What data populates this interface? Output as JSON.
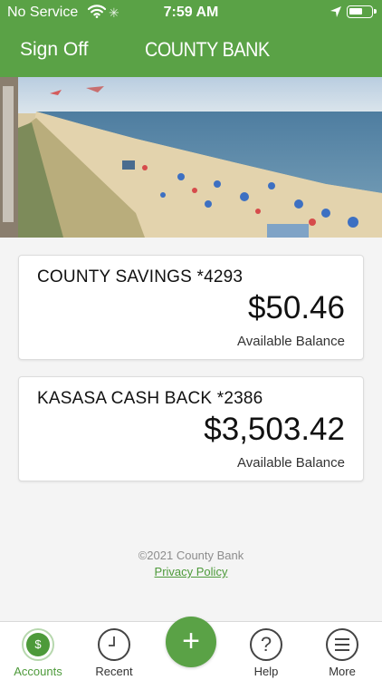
{
  "status_bar": {
    "carrier": "No Service",
    "time": "7:59 AM",
    "icons": [
      "wifi-icon",
      "loading-spinner-icon",
      "location-arrow-icon",
      "battery-icon"
    ]
  },
  "header": {
    "sign_off_label": "Sign Off",
    "brand": "COUNTY BANK",
    "color": "#5aa246"
  },
  "accounts": [
    {
      "name": "COUNTY SAVINGS *4293",
      "balance": "$50.46",
      "balance_label": "Available Balance"
    },
    {
      "name": "KASASA CASH BACK *2386",
      "balance": "$3,503.42",
      "balance_label": "Available Balance"
    }
  ],
  "footer": {
    "copyright": "©2021 County Bank",
    "privacy_link": "Privacy Policy"
  },
  "tabbar": {
    "accounts": {
      "label": "Accounts",
      "icon": "dollar-icon",
      "symbol": "$"
    },
    "recent": {
      "label": "Recent",
      "icon": "clock-icon"
    },
    "add": {
      "icon": "plus-icon",
      "symbol": "+"
    },
    "help": {
      "label": "Help",
      "icon": "question-icon",
      "symbol": "?"
    },
    "more": {
      "label": "More",
      "icon": "menu-icon"
    },
    "active_color": "#4d9a3a"
  }
}
